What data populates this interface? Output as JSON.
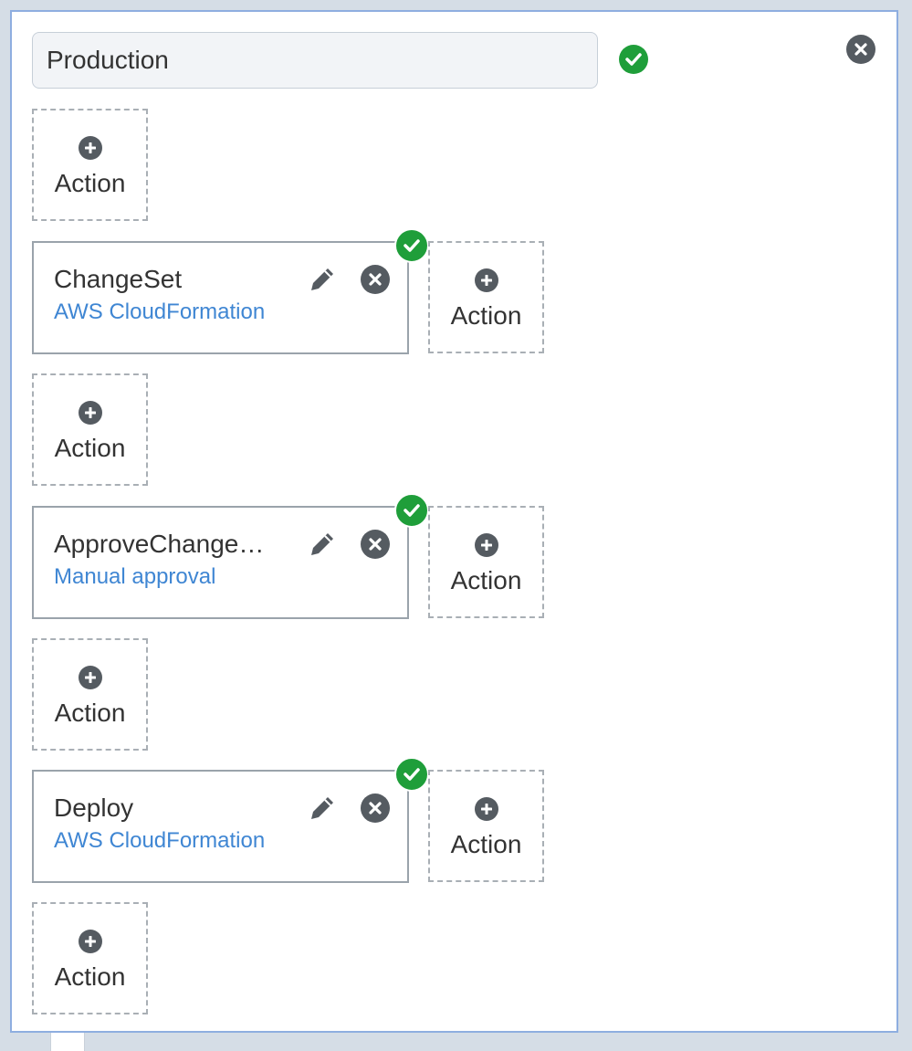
{
  "stage": {
    "name_value": "Production",
    "status_icon": "check-circle-icon",
    "close_icon": "close-circle-icon"
  },
  "add_action_label": "Action",
  "actions": [
    {
      "name": "ChangeSet",
      "provider": "AWS CloudFormation",
      "status_icon": "check-circle-icon"
    },
    {
      "name": "ApproveChange…",
      "provider": "Manual approval",
      "status_icon": "check-circle-icon"
    },
    {
      "name": "Deploy",
      "provider": "AWS CloudFormation",
      "status_icon": "check-circle-icon"
    }
  ],
  "colors": {
    "success": "#1f9e3a",
    "icon_dark": "#555b61",
    "link": "#3f86d3",
    "panel_border": "#8eaee0"
  }
}
